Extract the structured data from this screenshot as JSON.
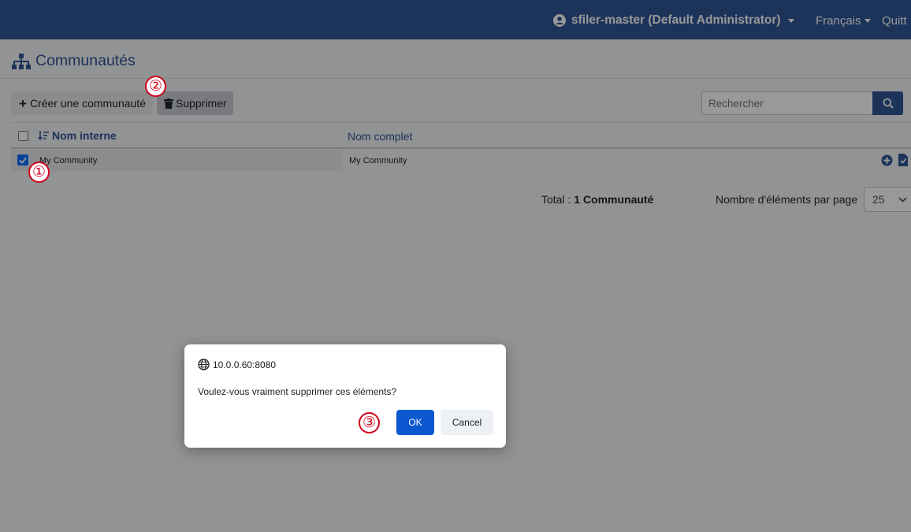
{
  "navbar": {
    "user_label": "sfiler-master (Default Administrator)",
    "language_label": "Français",
    "quit_label": "Quitt"
  },
  "page": {
    "title": "Communautés"
  },
  "toolbar": {
    "create_label": "Créer une communauté",
    "delete_label": "Supprimer",
    "search_placeholder": "Rechercher"
  },
  "table": {
    "columns": [
      "Nom interne",
      "Nom complet"
    ],
    "rows": [
      {
        "internal_name": "My Community",
        "full_name": "My Community",
        "selected": true
      }
    ]
  },
  "footer": {
    "total_prefix": "Total : ",
    "total_value": "1 Communauté",
    "per_page_label": "Nombre d'éléments par page",
    "per_page_value": "25"
  },
  "dialog": {
    "origin": "10.0.0.60:8080",
    "message": "Voulez-vous vraiment supprimer ces éléments?",
    "ok_label": "OK",
    "cancel_label": "Cancel"
  },
  "annotations": [
    "①",
    "②",
    "③"
  ],
  "colors": {
    "navbar": "#2f5597",
    "accent": "#2f5597",
    "ok_button": "#0b57d0",
    "checkbox": "#0d6efd",
    "annotation": "#d0021b"
  },
  "icons": [
    "user-circle-icon",
    "sitemap-icon",
    "plus-icon",
    "trash-icon",
    "search-icon",
    "sort-icon",
    "check-icon",
    "plus-circle-icon",
    "edit-icon",
    "chevron-down-icon",
    "globe-icon"
  ]
}
